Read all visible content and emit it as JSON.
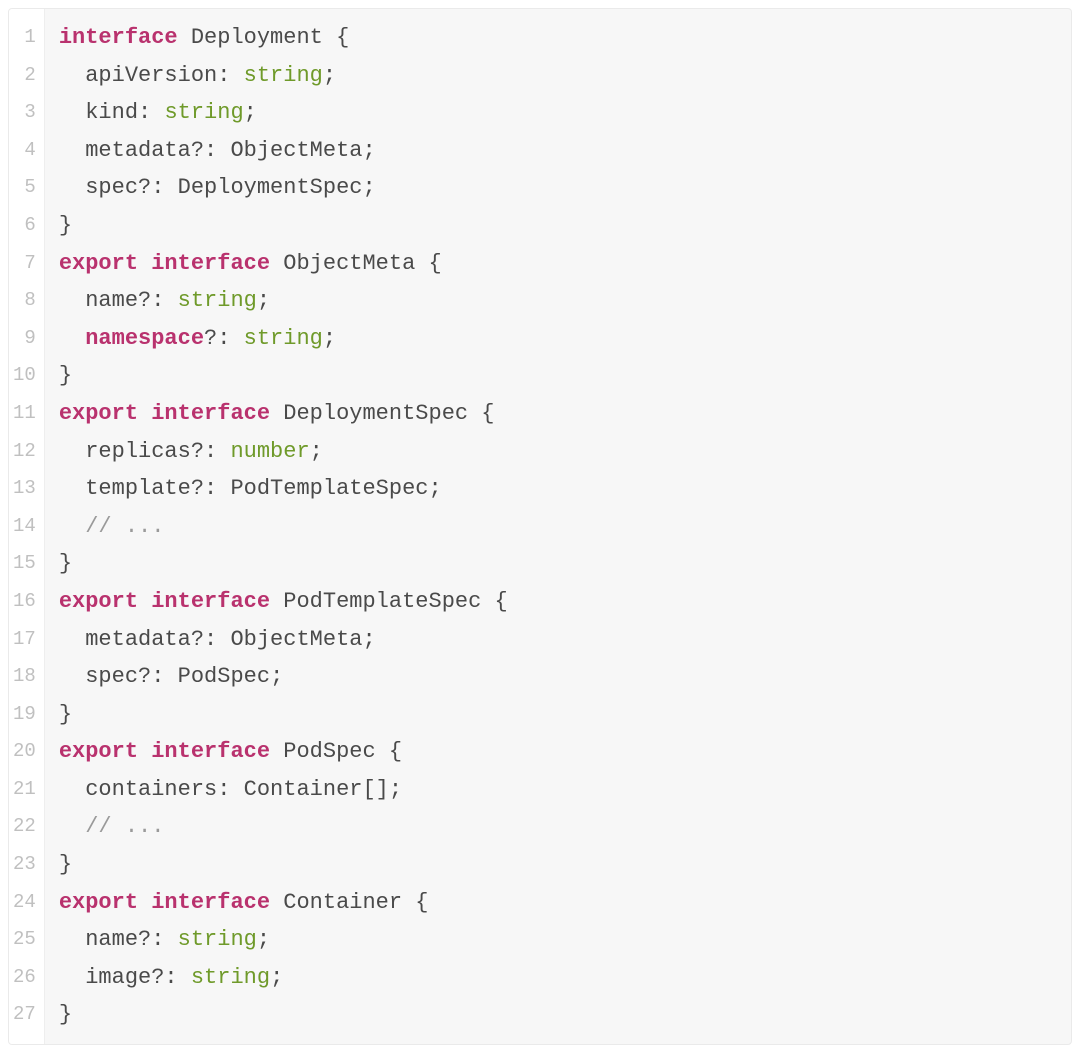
{
  "code": {
    "lineCount": 27,
    "lines": [
      [
        {
          "c": "kw",
          "t": "interface"
        },
        {
          "c": "pn",
          "t": " "
        },
        {
          "c": "nm",
          "t": "Deployment"
        },
        {
          "c": "pn",
          "t": " {"
        }
      ],
      [
        {
          "c": "pn",
          "t": "  "
        },
        {
          "c": "nm",
          "t": "apiVersion"
        },
        {
          "c": "pn",
          "t": ": "
        },
        {
          "c": "typ",
          "t": "string"
        },
        {
          "c": "pn",
          "t": ";"
        }
      ],
      [
        {
          "c": "pn",
          "t": "  "
        },
        {
          "c": "nm",
          "t": "kind"
        },
        {
          "c": "pn",
          "t": ": "
        },
        {
          "c": "typ",
          "t": "string"
        },
        {
          "c": "pn",
          "t": ";"
        }
      ],
      [
        {
          "c": "pn",
          "t": "  "
        },
        {
          "c": "nm",
          "t": "metadata"
        },
        {
          "c": "pn",
          "t": "?: "
        },
        {
          "c": "nm",
          "t": "ObjectMeta"
        },
        {
          "c": "pn",
          "t": ";"
        }
      ],
      [
        {
          "c": "pn",
          "t": "  "
        },
        {
          "c": "nm",
          "t": "spec"
        },
        {
          "c": "pn",
          "t": "?: "
        },
        {
          "c": "nm",
          "t": "DeploymentSpec"
        },
        {
          "c": "pn",
          "t": ";"
        }
      ],
      [
        {
          "c": "pn",
          "t": "}"
        }
      ],
      [
        {
          "c": "kw",
          "t": "export"
        },
        {
          "c": "pn",
          "t": " "
        },
        {
          "c": "kw",
          "t": "interface"
        },
        {
          "c": "pn",
          "t": " "
        },
        {
          "c": "nm",
          "t": "ObjectMeta"
        },
        {
          "c": "pn",
          "t": " {"
        }
      ],
      [
        {
          "c": "pn",
          "t": "  "
        },
        {
          "c": "nm",
          "t": "name"
        },
        {
          "c": "pn",
          "t": "?: "
        },
        {
          "c": "typ",
          "t": "string"
        },
        {
          "c": "pn",
          "t": ";"
        }
      ],
      [
        {
          "c": "pn",
          "t": "  "
        },
        {
          "c": "opt",
          "t": "namespace"
        },
        {
          "c": "pn",
          "t": "?: "
        },
        {
          "c": "typ",
          "t": "string"
        },
        {
          "c": "pn",
          "t": ";"
        }
      ],
      [
        {
          "c": "pn",
          "t": "}"
        }
      ],
      [
        {
          "c": "kw",
          "t": "export"
        },
        {
          "c": "pn",
          "t": " "
        },
        {
          "c": "kw",
          "t": "interface"
        },
        {
          "c": "pn",
          "t": " "
        },
        {
          "c": "nm",
          "t": "DeploymentSpec"
        },
        {
          "c": "pn",
          "t": " {"
        }
      ],
      [
        {
          "c": "pn",
          "t": "  "
        },
        {
          "c": "nm",
          "t": "replicas"
        },
        {
          "c": "pn",
          "t": "?: "
        },
        {
          "c": "typ",
          "t": "number"
        },
        {
          "c": "pn",
          "t": ";"
        }
      ],
      [
        {
          "c": "pn",
          "t": "  "
        },
        {
          "c": "nm",
          "t": "template"
        },
        {
          "c": "pn",
          "t": "?: "
        },
        {
          "c": "nm",
          "t": "PodTemplateSpec"
        },
        {
          "c": "pn",
          "t": ";"
        }
      ],
      [
        {
          "c": "pn",
          "t": "  "
        },
        {
          "c": "cm",
          "t": "// ..."
        }
      ],
      [
        {
          "c": "pn",
          "t": "}"
        }
      ],
      [
        {
          "c": "kw",
          "t": "export"
        },
        {
          "c": "pn",
          "t": " "
        },
        {
          "c": "kw",
          "t": "interface"
        },
        {
          "c": "pn",
          "t": " "
        },
        {
          "c": "nm",
          "t": "PodTemplateSpec"
        },
        {
          "c": "pn",
          "t": " {"
        }
      ],
      [
        {
          "c": "pn",
          "t": "  "
        },
        {
          "c": "nm",
          "t": "metadata"
        },
        {
          "c": "pn",
          "t": "?: "
        },
        {
          "c": "nm",
          "t": "ObjectMeta"
        },
        {
          "c": "pn",
          "t": ";"
        }
      ],
      [
        {
          "c": "pn",
          "t": "  "
        },
        {
          "c": "nm",
          "t": "spec"
        },
        {
          "c": "pn",
          "t": "?: "
        },
        {
          "c": "nm",
          "t": "PodSpec"
        },
        {
          "c": "pn",
          "t": ";"
        }
      ],
      [
        {
          "c": "pn",
          "t": "}"
        }
      ],
      [
        {
          "c": "kw",
          "t": "export"
        },
        {
          "c": "pn",
          "t": " "
        },
        {
          "c": "kw",
          "t": "interface"
        },
        {
          "c": "pn",
          "t": " "
        },
        {
          "c": "nm",
          "t": "PodSpec"
        },
        {
          "c": "pn",
          "t": " {"
        }
      ],
      [
        {
          "c": "pn",
          "t": "  "
        },
        {
          "c": "nm",
          "t": "containers"
        },
        {
          "c": "pn",
          "t": ": "
        },
        {
          "c": "nm",
          "t": "Container"
        },
        {
          "c": "pn",
          "t": "[];"
        }
      ],
      [
        {
          "c": "pn",
          "t": "  "
        },
        {
          "c": "cm",
          "t": "// ..."
        }
      ],
      [
        {
          "c": "pn",
          "t": "}"
        }
      ],
      [
        {
          "c": "kw",
          "t": "export"
        },
        {
          "c": "pn",
          "t": " "
        },
        {
          "c": "kw",
          "t": "interface"
        },
        {
          "c": "pn",
          "t": " "
        },
        {
          "c": "nm",
          "t": "Container"
        },
        {
          "c": "pn",
          "t": " {"
        }
      ],
      [
        {
          "c": "pn",
          "t": "  "
        },
        {
          "c": "nm",
          "t": "name"
        },
        {
          "c": "pn",
          "t": "?: "
        },
        {
          "c": "typ",
          "t": "string"
        },
        {
          "c": "pn",
          "t": ";"
        }
      ],
      [
        {
          "c": "pn",
          "t": "  "
        },
        {
          "c": "nm",
          "t": "image"
        },
        {
          "c": "pn",
          "t": "?: "
        },
        {
          "c": "typ",
          "t": "string"
        },
        {
          "c": "pn",
          "t": ";"
        }
      ],
      [
        {
          "c": "pn",
          "t": "}"
        }
      ]
    ]
  },
  "colors": {
    "keyword": "#b9326e",
    "type": "#6f9a2a",
    "comment": "#9a9a9a",
    "gutter": "#c0c0c0",
    "bg": "#f7f7f7"
  }
}
